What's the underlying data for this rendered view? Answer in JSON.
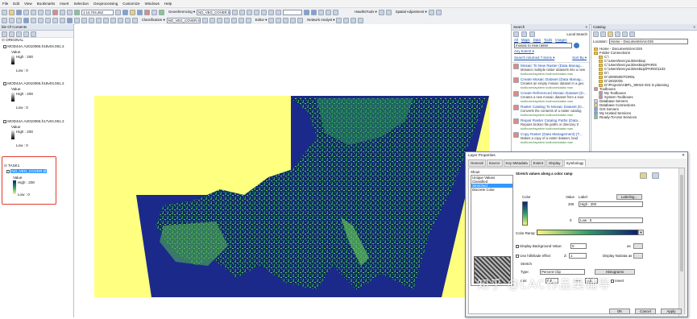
{
  "menus": [
    "File",
    "Edit",
    "View",
    "Bookmarks",
    "Insert",
    "Selection",
    "Geoprocessing",
    "Customize",
    "Windows",
    "Help"
  ],
  "toolbar": {
    "scale": "1:14,704,462",
    "georeferencing_label": "Georeferencing ▾",
    "georef_layer": "NO_VEG_COVER.tif",
    "classification_label": "Classification ▾",
    "classification_layer": "NO_VEG_COVER.tif",
    "editor_label": "Editor ▾",
    "network_analyst_label": "Network Analyst ▾",
    "hawths_tools_label": "HawthsTools ▾",
    "spatial_adjustment_label": "Spatial Adjustment ▾"
  },
  "toc": {
    "title": "ble Of Contents",
    "group_original": "ORIGINAL",
    "layers": [
      {
        "name": "MOD44A.A2010065.h18v04.061.2",
        "value_label": "Value",
        "high": "High : 200",
        "low": "Low : 0"
      },
      {
        "name": "MOD44A.A2010065.h18v03.061.2",
        "value_label": "Value",
        "high": "High : 200",
        "low": "Low : 0"
      },
      {
        "name": "MOD44A.A2010065.h17v04.061.2",
        "value_label": "Value",
        "high": "High : 200",
        "low": "Low : 0"
      }
    ],
    "group_task": "TASK1",
    "task_layer": {
      "name": "NO_VEG_COVER.tif",
      "value_label": "Value",
      "high": "High : 200",
      "low": "Low : 0"
    }
  },
  "search": {
    "title": "Search",
    "tabs": [
      "All",
      "Maps",
      "Data",
      "Tools",
      "Images"
    ],
    "local_search": "Local Search",
    "query": "mosaic to new raster",
    "any_extent": "Any Extent ▾",
    "searched_for": "Search returned 7 items ▾",
    "sort_by": "Sort By ▾",
    "results": [
      {
        "title": "Mosaic To New Raster (Data Manag...",
        "desc": "Mosaics multiple raster datasets into a new",
        "path": "toolboxes\\system toolboxes\\data man"
      },
      {
        "title": "Create Mosaic Dataset (Data Manag...",
        "desc": "Creates an empty mosaic dataset in a geo",
        "path": "toolboxes\\system toolboxes\\data man"
      },
      {
        "title": "Create Referenced Mosaic Dataset (D...",
        "desc": "Creates a new mosaic dataset from a sour",
        "path": "toolboxes\\system toolboxes\\data man"
      },
      {
        "title": "Raster Catalog To Mosaic Dataset (D...",
        "desc": "Converts the contents of a raster catalog",
        "path": "toolboxes\\system toolboxes\\data man"
      },
      {
        "title": "Repair Raster Catalog Paths (Data...",
        "desc": "Repairs broken file paths or directory tr",
        "path": "toolboxes\\system toolboxes\\data man"
      },
      {
        "title": "Copy Raster (Data Management) (T...",
        "desc": "Makes a copy of a raster dataset, load",
        "path": "toolboxes\\system toolboxes\\data man"
      }
    ]
  },
  "catalog": {
    "title": "Catalog",
    "location_label": "Location:",
    "location_value": "Home - Documents\\ArcGIS",
    "items": [
      "Home - Documents\\ArcGIS",
      "Folder Connections",
      "C:\\",
      "C:\\Users\\tencyou\\Desktop",
      "C:\\Users\\tencyou\\Desktop\\PARIS",
      "C:\\Users\\tencyou\\Desktop\\PARIS\\1102",
      "D:\\",
      "D:\\2000505\\TOR0L",
      "D:\\2022025",
      "D:\\Projects\\ABPL_90019 GIS in planning",
      "Toolboxes",
      "My Toolboxes",
      "System Toolboxes",
      "Database Servers",
      "Database Connections",
      "GIS Servers",
      "My Hosted Services",
      "Ready-To-Use Services"
    ]
  },
  "dialog": {
    "title": "Layer Properties",
    "close": "✕",
    "tabs": [
      "General",
      "Source",
      "Key Metadata",
      "Extent",
      "Display",
      "Symbology"
    ],
    "active_tab": "Symbology",
    "show_label": "Show:",
    "show_items": [
      "Unique Values",
      "Classified",
      "Stretched",
      "Discrete Color"
    ],
    "heading": "Stretch values along a color ramp",
    "color_label": "Color",
    "value_label": "Value",
    "label_label": "Label",
    "labeling_button": "Labeling...",
    "high_value": "200",
    "high_label": "High : 200",
    "low_value": "0",
    "low_label": "Low : 0",
    "color_ramp_label": "Color Ramp:",
    "display_background": "Display Background Value:",
    "background_value": "0",
    "as_label": "as",
    "use_hillshade": "Use hillshade effect",
    "z_label": "Z:",
    "z_value": "1",
    "display_nodata": "Display NoData as",
    "stretch_label": "Stretch",
    "type_label": "Type:",
    "type_value": "Percent Clip",
    "histograms_button": "Histograms",
    "min_label": "min:",
    "min_value": "0.5",
    "max_label": "max:",
    "max_value": "0.5",
    "invert_label": "Invert",
    "ok": "OK",
    "cancel": "Cancel",
    "apply": "Apply"
  },
  "watermark": "知乎 @LAC作品集辅导",
  "colors": {
    "map_background": "#ffff80",
    "map_nodata": "#1b2a8a",
    "ramp_high": "#0b1f7a",
    "ramp_mid": "#2c9e6a",
    "ramp_low": "#f7f77a",
    "highlight_red": "#e03b2f"
  }
}
